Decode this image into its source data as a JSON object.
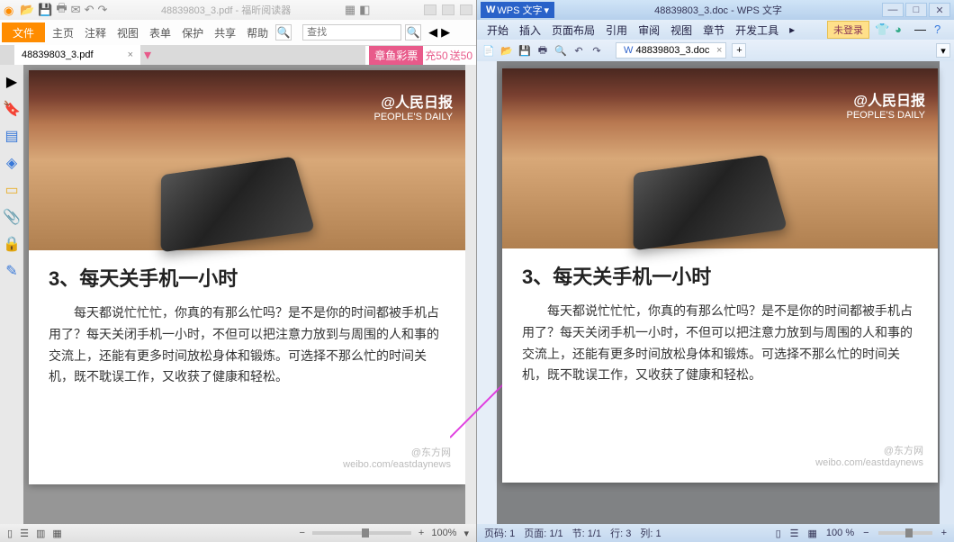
{
  "foxit": {
    "window_title": "48839803_3.pdf - 福昕阅读器",
    "file_button": "文件",
    "ribbon": [
      "主页",
      "注释",
      "视图",
      "表单",
      "保护",
      "共享",
      "帮助"
    ],
    "search_placeholder": "查找",
    "tab_label": "48839803_3.pdf",
    "promo_brand": "章鱼彩票",
    "promo_charge": "充50",
    "promo_gift": "送50",
    "status_zoom": "100%"
  },
  "wps": {
    "app_tag": "WPS 文字",
    "window_title": "48839803_3.doc - WPS 文字",
    "menus": [
      "开始",
      "插入",
      "页面布局",
      "引用",
      "审阅",
      "视图",
      "章节",
      "开发工具"
    ],
    "login": "未登录",
    "doctab": "48839803_3.doc",
    "status": {
      "page_label": "页码:",
      "page_val": "1",
      "pages_label": "页面:",
      "pages_val": "1/1",
      "section_label": "节:",
      "section_val": "1/1",
      "row_label": "行:",
      "row_val": "3",
      "col_label": "列:",
      "col_val": "1",
      "zoom": "100 %"
    }
  },
  "doc": {
    "logo_brand": "人民日报",
    "logo_en": "PEOPLE'S DAILY",
    "heading": "3、每天关手机一小时",
    "body": "每天都说忙忙忙，你真的有那么忙吗？是不是你的时间都被手机占用了？每天关闭手机一小时，不但可以把注意力放到与周围的人和事的交流上，还能有更多时间放松身体和锻炼。可选择不那么忙的时间关机，既不耽误工作，又收获了健康和轻松。",
    "source_handle": "@东方网",
    "source_url": "weibo.com/eastdaynews"
  }
}
